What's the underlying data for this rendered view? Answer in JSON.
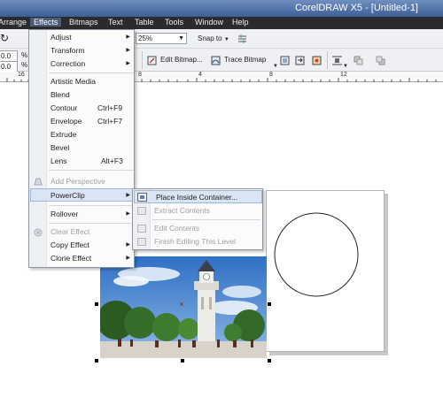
{
  "window": {
    "title": "CorelDRAW X5 - [Untitled-1]"
  },
  "menubar": [
    "Arrange",
    "Effects",
    "Bitmaps",
    "Text",
    "Table",
    "Tools",
    "Window",
    "Help"
  ],
  "toolbar1": {
    "zoom_value": "25%",
    "snap_label": "Snap to"
  },
  "property_bar": {
    "x_value": "0.0",
    "y_value": "0.0",
    "unit": "%",
    "edit_bitmap_label": "Edit Bitmap...",
    "trace_bitmap_label": "Trace Bitmap"
  },
  "ruler": {
    "ticks": [
      "16",
      "8",
      "4",
      "8",
      "12"
    ]
  },
  "effects_menu": {
    "items": [
      {
        "label": "Adjust",
        "shortcut": "",
        "submenu": true,
        "disabled": false
      },
      {
        "label": "Transform",
        "shortcut": "",
        "submenu": true,
        "disabled": false
      },
      {
        "label": "Correction",
        "shortcut": "",
        "submenu": true,
        "disabled": false
      },
      {
        "label": "Artistic Media",
        "shortcut": "",
        "submenu": false,
        "disabled": false
      },
      {
        "label": "Blend",
        "shortcut": "",
        "submenu": false,
        "disabled": false
      },
      {
        "label": "Contour",
        "shortcut": "Ctrl+F9",
        "submenu": false,
        "disabled": false
      },
      {
        "label": "Envelope",
        "shortcut": "Ctrl+F7",
        "submenu": false,
        "disabled": false
      },
      {
        "label": "Extrude",
        "shortcut": "",
        "submenu": false,
        "disabled": false
      },
      {
        "label": "Bevel",
        "shortcut": "",
        "submenu": false,
        "disabled": false
      },
      {
        "label": "Lens",
        "shortcut": "Alt+F3",
        "submenu": false,
        "disabled": false
      },
      {
        "label": "Add Perspective",
        "shortcut": "",
        "submenu": false,
        "disabled": true
      },
      {
        "label": "PowerClip",
        "shortcut": "",
        "submenu": true,
        "disabled": false
      },
      {
        "label": "Rollover",
        "shortcut": "",
        "submenu": true,
        "disabled": false
      },
      {
        "label": "Clear Effect",
        "shortcut": "",
        "submenu": false,
        "disabled": true
      },
      {
        "label": "Copy Effect",
        "shortcut": "",
        "submenu": true,
        "disabled": false
      },
      {
        "label": "Clone Effect",
        "shortcut": "",
        "submenu": true,
        "disabled": false
      }
    ]
  },
  "powerclip_submenu": {
    "items": [
      {
        "label": "Place Inside Container...",
        "disabled": false
      },
      {
        "label": "Extract Contents",
        "disabled": true
      },
      {
        "label": "Edit Contents",
        "disabled": true
      },
      {
        "label": "Finish Editing This Level",
        "disabled": true
      }
    ]
  }
}
